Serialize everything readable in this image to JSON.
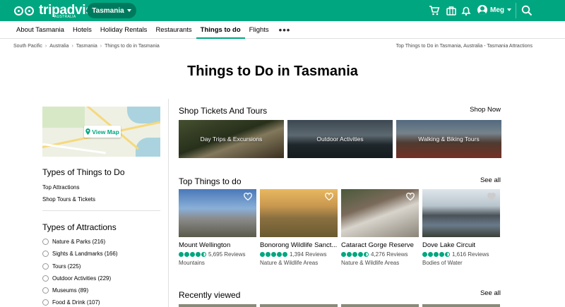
{
  "header": {
    "logo_text": "tripadvisor",
    "logo_sub": "AUSTRALIA",
    "location": "Tasmania",
    "user_name": "Meg",
    "icons": [
      "cart-icon",
      "bag-icon",
      "bell-icon",
      "user-icon",
      "search-icon"
    ],
    "colors": {
      "brand": "#00a680",
      "brand_dark": "#007a5e"
    }
  },
  "nav": {
    "items": [
      {
        "label": "About Tasmania"
      },
      {
        "label": "Hotels"
      },
      {
        "label": "Holiday Rentals"
      },
      {
        "label": "Restaurants"
      },
      {
        "label": "Things to do",
        "active": true
      },
      {
        "label": "Flights"
      }
    ],
    "more": "•••"
  },
  "breadcrumb": {
    "items": [
      "South Pacific",
      "Australia",
      "Tasmania",
      "Things to do in Tasmania"
    ],
    "right": "Top Things to Do in Tasmania, Australia - Tasmania Attractions"
  },
  "page_title": "Things to Do in Tasmania",
  "sidebar": {
    "map_button": "View Map",
    "types_heading": "Types of Things to Do",
    "types_links": [
      "Top Attractions",
      "Shop Tours & Tickets"
    ],
    "attractions_heading": "Types of Attractions",
    "attractions": [
      "Nature & Parks (216)",
      "Sights & Landmarks (166)",
      "Tours (225)",
      "Outdoor Activities (229)",
      "Museums (89)",
      "Food & Drink (107)"
    ]
  },
  "tickets": {
    "heading": "Shop Tickets And Tours",
    "link": "Shop Now",
    "tiles": [
      "Day Trips & Excursions",
      "Outdoor Activities",
      "Walking & Biking Tours"
    ]
  },
  "top": {
    "heading": "Top Things to do",
    "link": "See all",
    "cards": [
      {
        "title": "Mount Wellington",
        "reviews": "5,695 Reviews",
        "category": "Mountains",
        "rating": 4.5
      },
      {
        "title": "Bonorong Wildlife Sanct...",
        "reviews": "1,394 Reviews",
        "category": "Nature & Wildlife Areas",
        "rating": 5
      },
      {
        "title": "Cataract Gorge Reserve",
        "reviews": "4,276 Reviews",
        "category": "Nature & Wildlife Areas",
        "rating": 4.5
      },
      {
        "title": "Dove Lake Circuit",
        "reviews": "1,616 Reviews",
        "category": "Bodies of Water",
        "rating": 4.5
      }
    ]
  },
  "recent": {
    "heading": "Recently viewed",
    "link": "See all"
  }
}
